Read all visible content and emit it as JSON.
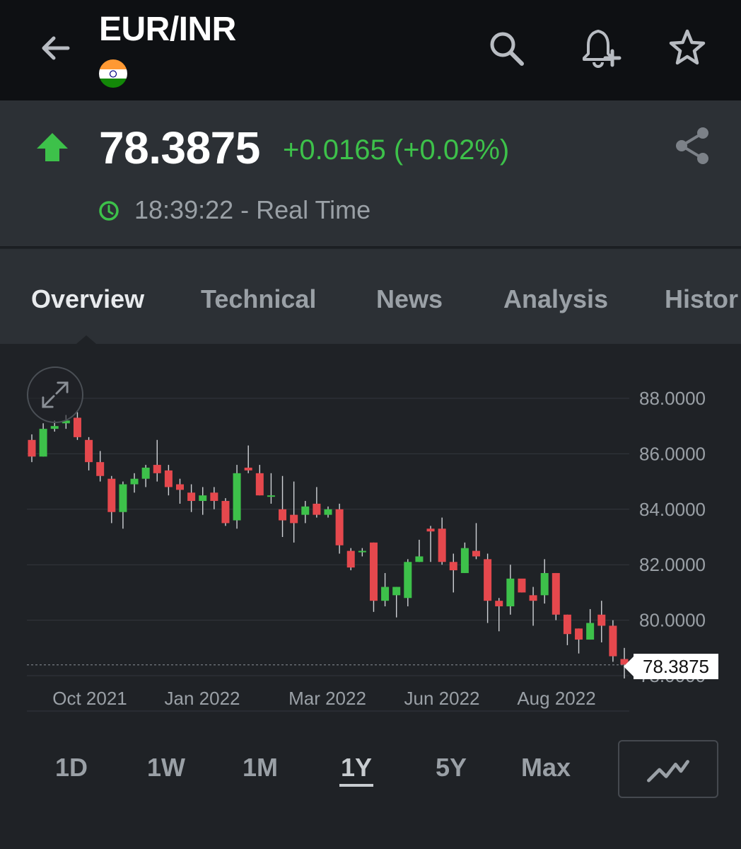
{
  "header": {
    "pair": "EUR/INR",
    "back_icon": "arrow-left-icon",
    "flag_icon": "india-flag-icon",
    "actions": [
      "search-icon",
      "add-alert-icon",
      "star-icon"
    ]
  },
  "quote": {
    "price": "78.3875",
    "change": "+0.0165 (+0.02%)",
    "time": "18:39:22 - Real Time",
    "up_color": "#3dc14a",
    "down_color": "#e5484d"
  },
  "tabs": [
    {
      "label": "Overview",
      "active": true
    },
    {
      "label": "Technical",
      "active": false
    },
    {
      "label": "News",
      "active": false
    },
    {
      "label": "Analysis",
      "active": false
    },
    {
      "label": "Histor",
      "active": false
    }
  ],
  "chart_data": {
    "type": "candlestick",
    "y_ticks": [
      "88.0000",
      "86.0000",
      "84.0000",
      "82.0000",
      "80.0000",
      "78.0000"
    ],
    "x_ticks": [
      "Oct 2021",
      "Jan 2022",
      "Mar 2022",
      "Jun 2022",
      "Aug 2022"
    ],
    "ylim": [
      77.5,
      89
    ],
    "current_price": "78.3875",
    "candles": [
      [
        86.5,
        85.9,
        86.7,
        85.7
      ],
      [
        85.9,
        86.9,
        87.1,
        85.9
      ],
      [
        86.9,
        87.0,
        87.2,
        86.8
      ],
      [
        87.1,
        87.2,
        87.4,
        86.9
      ],
      [
        87.3,
        86.6,
        87.5,
        86.5
      ],
      [
        86.5,
        85.7,
        86.6,
        85.4
      ],
      [
        85.7,
        85.2,
        86.1,
        85.0
      ],
      [
        85.1,
        83.9,
        85.2,
        83.5
      ],
      [
        83.9,
        84.9,
        85.0,
        83.3
      ],
      [
        84.9,
        85.1,
        85.3,
        84.6
      ],
      [
        85.1,
        85.5,
        85.6,
        84.8
      ],
      [
        85.6,
        85.3,
        86.5,
        85.0
      ],
      [
        85.4,
        84.8,
        85.6,
        84.5
      ],
      [
        84.9,
        84.7,
        85.1,
        84.2
      ],
      [
        84.6,
        84.3,
        84.9,
        83.9
      ],
      [
        84.3,
        84.5,
        84.8,
        83.8
      ],
      [
        84.6,
        84.3,
        84.8,
        84.0
      ],
      [
        84.3,
        83.5,
        84.4,
        83.4
      ],
      [
        83.6,
        85.3,
        85.6,
        83.3
      ],
      [
        85.5,
        85.4,
        86.3,
        85.3
      ],
      [
        85.3,
        84.5,
        85.6,
        84.5
      ],
      [
        84.5,
        84.5,
        85.3,
        84.2
      ],
      [
        84.0,
        83.6,
        85.2,
        83.0
      ],
      [
        83.8,
        83.5,
        85.0,
        82.8
      ],
      [
        83.8,
        84.1,
        84.3,
        83.5
      ],
      [
        84.2,
        83.8,
        84.8,
        83.7
      ],
      [
        83.8,
        84.0,
        84.1,
        83.7
      ],
      [
        84.0,
        82.7,
        84.2,
        82.4
      ],
      [
        82.5,
        81.9,
        82.6,
        81.8
      ],
      [
        82.5,
        82.5,
        82.6,
        82.3
      ],
      [
        82.8,
        80.7,
        82.8,
        80.3
      ],
      [
        80.7,
        81.2,
        81.7,
        80.5
      ],
      [
        80.9,
        81.2,
        81.2,
        80.1
      ],
      [
        80.8,
        82.1,
        82.2,
        80.5
      ],
      [
        82.1,
        82.3,
        82.9,
        82.1
      ],
      [
        83.3,
        83.2,
        83.4,
        82.1
      ],
      [
        83.3,
        82.1,
        83.7,
        82.0
      ],
      [
        82.1,
        81.8,
        82.4,
        81.0
      ],
      [
        81.7,
        82.6,
        82.8,
        81.7
      ],
      [
        82.5,
        82.3,
        83.5,
        82.2
      ],
      [
        82.2,
        80.7,
        82.4,
        79.9
      ],
      [
        80.7,
        80.5,
        80.8,
        79.6
      ],
      [
        80.5,
        81.5,
        82.0,
        80.2
      ],
      [
        81.5,
        81.0,
        81.4,
        81.0
      ],
      [
        80.9,
        80.7,
        81.2,
        79.8
      ],
      [
        80.9,
        81.7,
        82.2,
        80.6
      ],
      [
        81.7,
        80.2,
        81.7,
        80.0
      ],
      [
        80.2,
        79.5,
        80.2,
        79.1
      ],
      [
        79.7,
        79.3,
        79.7,
        78.8
      ],
      [
        79.3,
        79.9,
        80.4,
        79.3
      ],
      [
        80.2,
        79.8,
        80.7,
        79.2
      ],
      [
        79.8,
        78.7,
        80.0,
        78.5
      ],
      [
        78.6,
        78.4,
        79.0,
        77.9
      ]
    ]
  },
  "ranges": [
    {
      "label": "1D",
      "active": false
    },
    {
      "label": "1W",
      "active": false
    },
    {
      "label": "1M",
      "active": false
    },
    {
      "label": "1Y",
      "active": true
    },
    {
      "label": "5Y",
      "active": false
    },
    {
      "label": "Max",
      "active": false
    }
  ],
  "chart_type_icon": "line-chart-icon"
}
